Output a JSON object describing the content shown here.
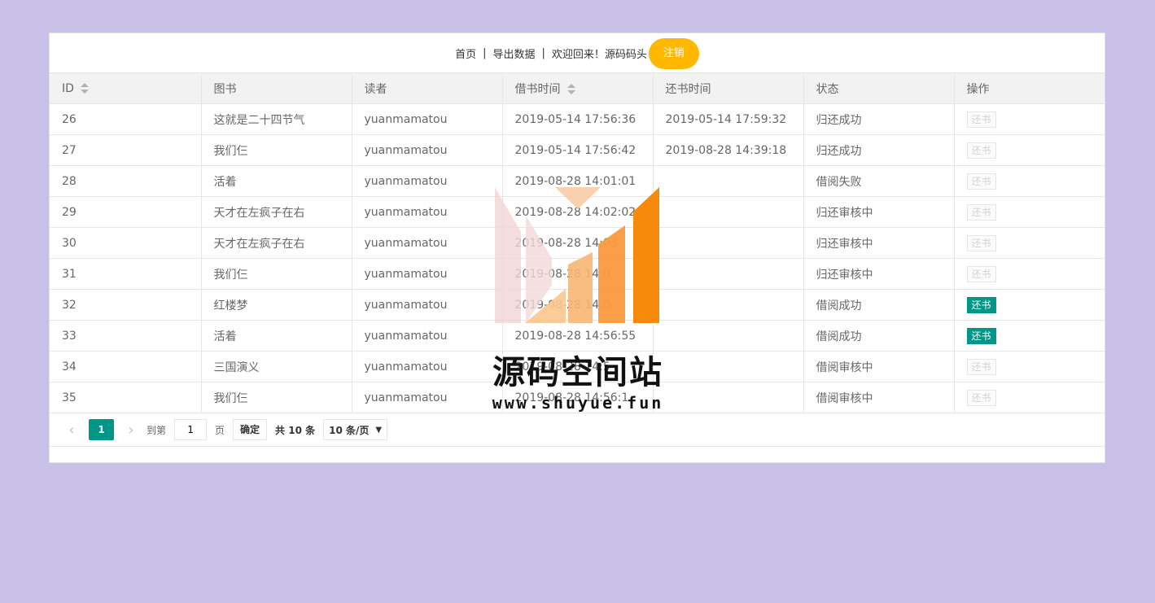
{
  "nav": {
    "home": "首页",
    "export": "导出数据",
    "separator": "|",
    "welcome": "欢迎回来！源码码头",
    "logout": "注销"
  },
  "table": {
    "columns": [
      "ID",
      "图书",
      "读者",
      "借书时间",
      "还书时间",
      "状态",
      "操作"
    ],
    "rows": [
      {
        "id": "26",
        "book": "这就是二十四节气",
        "reader": "yuanmamatou",
        "borrow": "2019-05-14 17:56:36",
        "return": "2019-05-14 17:59:32",
        "status": "归还成功",
        "action": "还书",
        "enabled": false
      },
      {
        "id": "27",
        "book": "我们仨",
        "reader": "yuanmamatou",
        "borrow": "2019-05-14 17:56:42",
        "return": "2019-08-28 14:39:18",
        "status": "归还成功",
        "action": "还书",
        "enabled": false
      },
      {
        "id": "28",
        "book": "活着",
        "reader": "yuanmamatou",
        "borrow": "2019-08-28 14:01:01",
        "return": "",
        "status": "借阅失败",
        "action": "还书",
        "enabled": false
      },
      {
        "id": "29",
        "book": "天才在左疯子在右",
        "reader": "yuanmamatou",
        "borrow": "2019-08-28 14:02:02",
        "return": "",
        "status": "归还审核中",
        "action": "还书",
        "enabled": false
      },
      {
        "id": "30",
        "book": "天才在左疯子在右",
        "reader": "yuanmamatou",
        "borrow": "2019-08-28 14:03",
        "return": "",
        "status": "归还审核中",
        "action": "还书",
        "enabled": false
      },
      {
        "id": "31",
        "book": "我们仨",
        "reader": "yuanmamatou",
        "borrow": "2019-08-28 14:0",
        "return": "",
        "status": "归还审核中",
        "action": "还书",
        "enabled": false
      },
      {
        "id": "32",
        "book": "红楼梦",
        "reader": "yuanmamatou",
        "borrow": "2019-08-28 14:0",
        "return": "",
        "status": "借阅成功",
        "action": "还书",
        "enabled": true
      },
      {
        "id": "33",
        "book": "活着",
        "reader": "yuanmamatou",
        "borrow": "2019-08-28 14:56:55",
        "return": "",
        "status": "借阅成功",
        "action": "还书",
        "enabled": true
      },
      {
        "id": "34",
        "book": "三国演义",
        "reader": "yuanmamatou",
        "borrow": "2019-08-28 14:5",
        "return": "",
        "status": "借阅审核中",
        "action": "还书",
        "enabled": false
      },
      {
        "id": "35",
        "book": "我们仨",
        "reader": "yuanmamatou",
        "borrow": "2019-08-28 14:56:1",
        "return": "",
        "status": "借阅审核中",
        "action": "还书",
        "enabled": false
      }
    ]
  },
  "pager": {
    "current": "1",
    "goto_label": "到第",
    "page_value": "1",
    "page_unit": "页",
    "confirm": "确定",
    "total": "共 10 条",
    "page_size": "10 条/页"
  },
  "watermark": {
    "title": "源码空间站",
    "url": "www.shuyue.fun"
  },
  "colors": {
    "background": "#c8c0e6",
    "accent": "#009688",
    "logout": "#FFB800"
  }
}
